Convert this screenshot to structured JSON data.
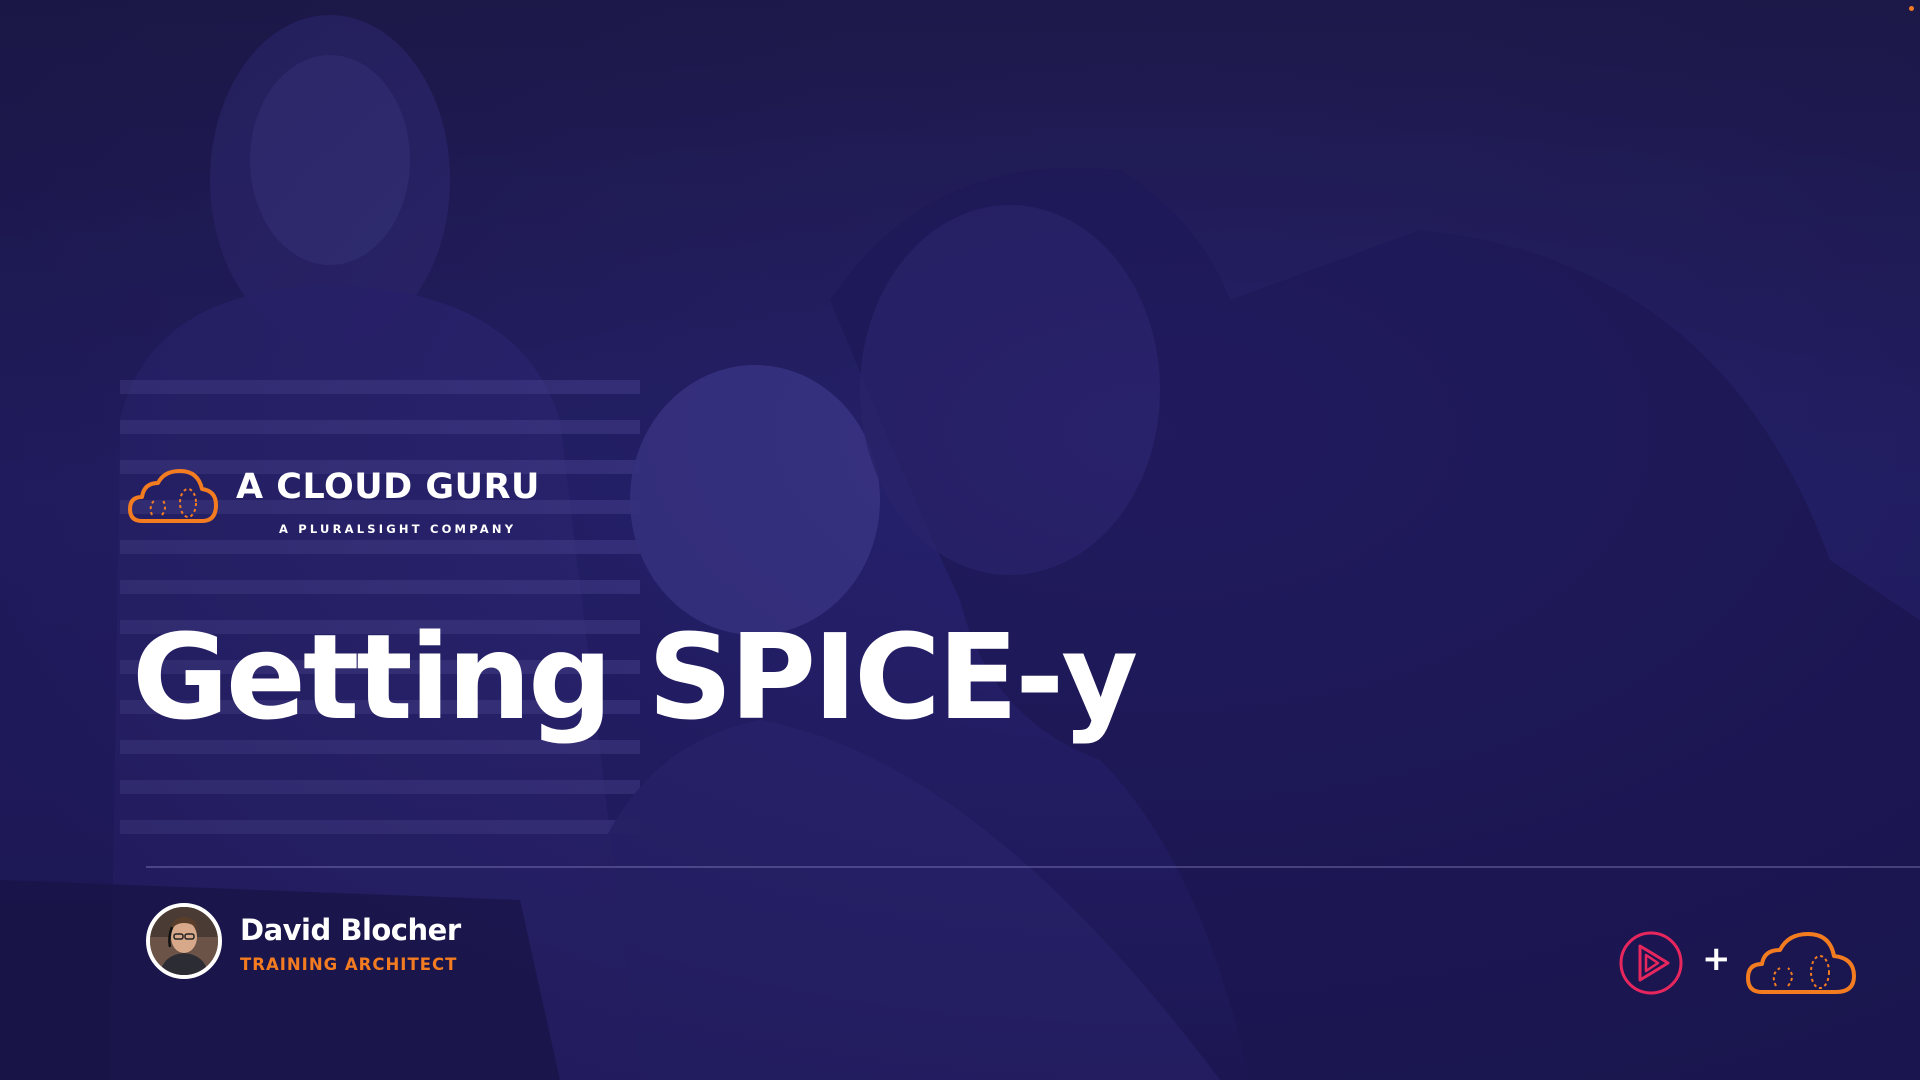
{
  "slide": {
    "title": "Getting SPICE-y"
  },
  "brand": {
    "name": "A CLOUD GURU",
    "tagline": "A PLURALSIGHT COMPANY",
    "logo_icon": "cloud-logo-icon",
    "accent_color": "#f47c20",
    "pluralsight_color": "#e8265e"
  },
  "presenter": {
    "name": "David Blocher",
    "role": "TRAINING ARCHITECT"
  },
  "footer": {
    "plus_symbol": "+"
  }
}
